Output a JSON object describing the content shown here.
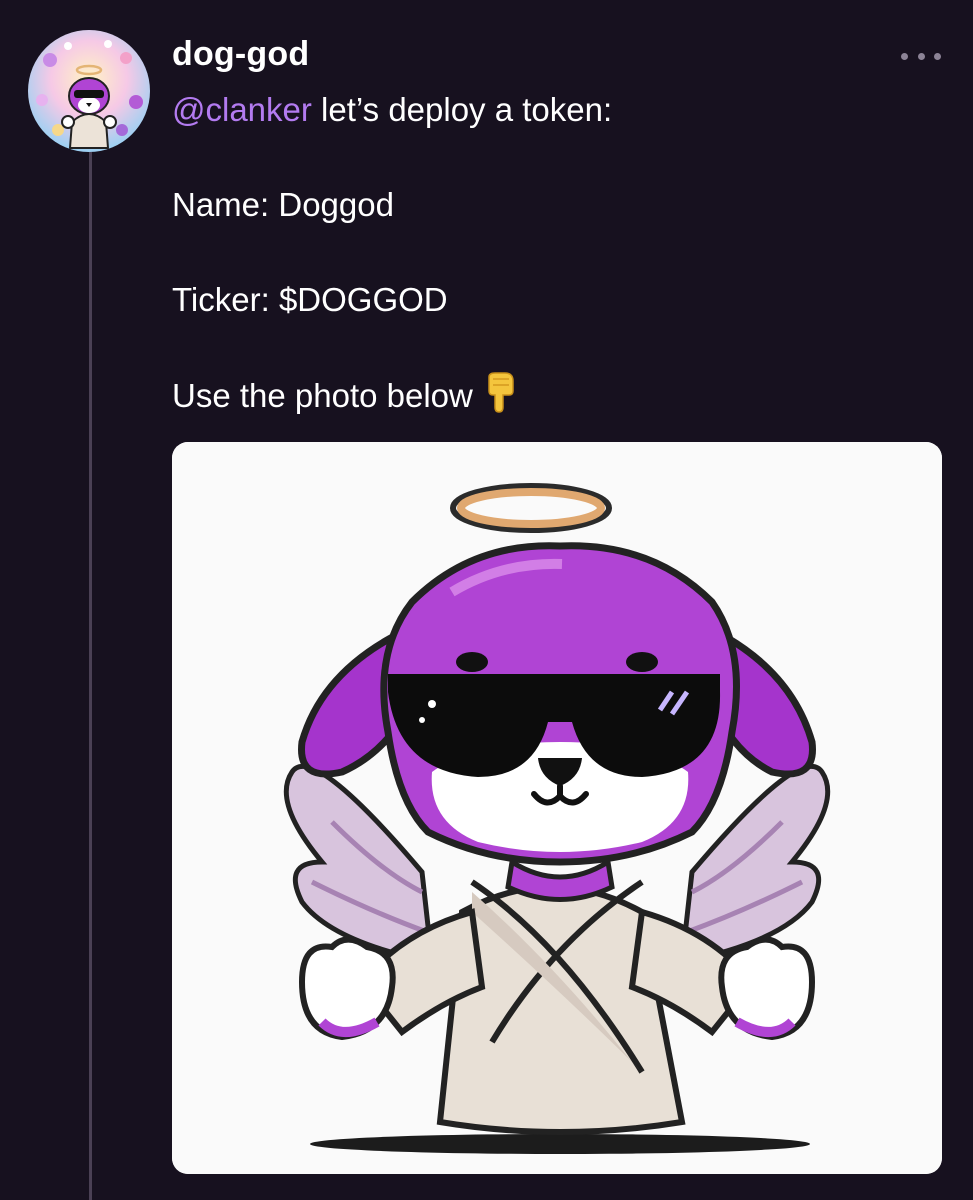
{
  "post": {
    "username": "dog-god",
    "mention": "@clanker",
    "text_line1": " let’s deploy a token:",
    "name_line": "Name: Doggod",
    "ticker_line": "Ticker: $DOGGOD",
    "photo_line": "Use the photo below",
    "emoji": "pointing-down-hand-emoji",
    "image_alt": "Cartoon purple dog angel with halo, sunglasses, wings and robe"
  },
  "icons": {
    "more": "more-horizontal-icon",
    "avatar": "doggod-avatar"
  },
  "colors": {
    "background": "#17111f",
    "mention": "#b37bf0",
    "dog_purple": "#b044d4",
    "robe": "#e8e0d6"
  }
}
